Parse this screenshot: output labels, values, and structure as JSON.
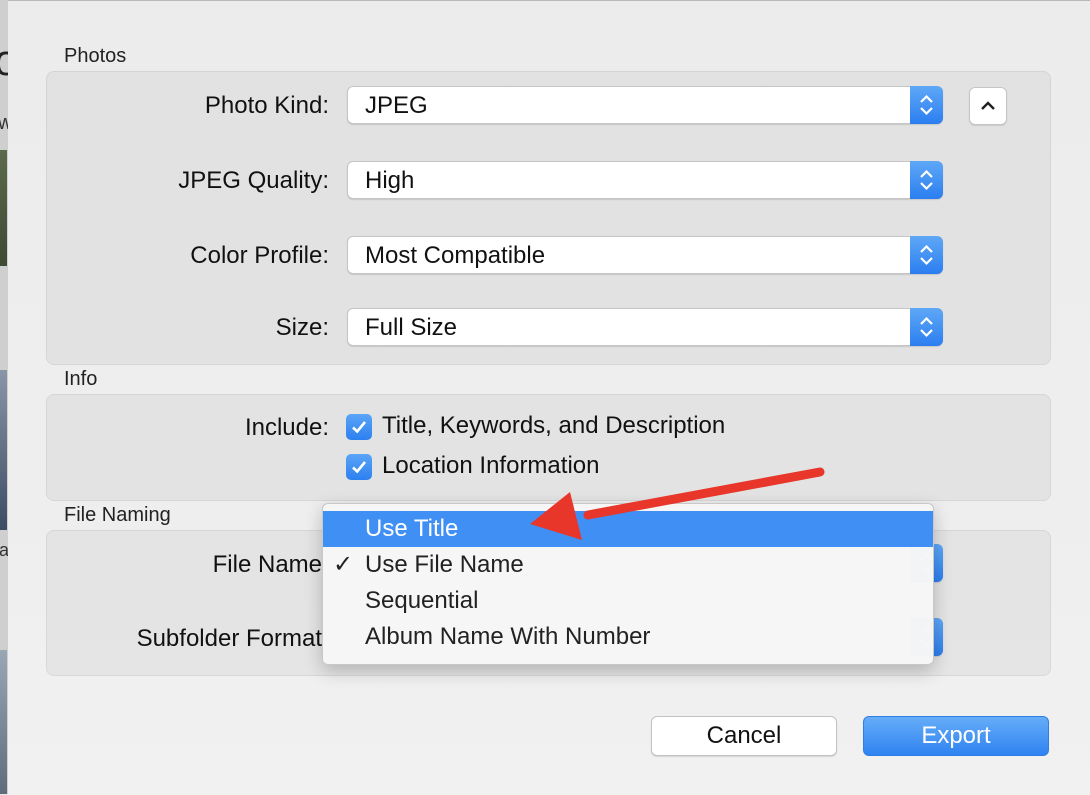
{
  "background": {
    "fragments": [
      "o",
      "w",
      "a"
    ]
  },
  "photos": {
    "section_title": "Photos",
    "photo_kind": {
      "label": "Photo Kind:",
      "value": "JPEG"
    },
    "jpeg_quality": {
      "label": "JPEG Quality:",
      "value": "High"
    },
    "color_profile": {
      "label": "Color Profile:",
      "value": "Most Compatible"
    },
    "size": {
      "label": "Size:",
      "value": "Full Size"
    }
  },
  "info": {
    "section_title": "Info",
    "include_label": "Include:",
    "options": [
      {
        "label": "Title, Keywords, and Description",
        "checked": true
      },
      {
        "label": "Location Information",
        "checked": true
      }
    ]
  },
  "file_naming": {
    "section_title": "File Naming",
    "file_name_label": "File Name",
    "subfolder_label": "Subfolder Format",
    "menu": {
      "items": [
        {
          "label": "Use Title",
          "highlighted": true,
          "checked": false
        },
        {
          "label": "Use File Name",
          "highlighted": false,
          "checked": true
        },
        {
          "label": "Sequential",
          "highlighted": false,
          "checked": false
        },
        {
          "label": "Album Name With Number",
          "highlighted": false,
          "checked": false
        }
      ],
      "check_glyph": "✓"
    }
  },
  "buttons": {
    "cancel": "Cancel",
    "export": "Export"
  },
  "colors": {
    "accent": "#3f8ff5",
    "annotation_arrow": "#e8362b"
  }
}
